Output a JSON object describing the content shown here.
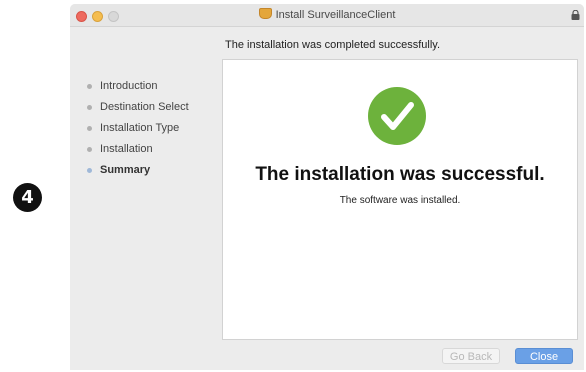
{
  "step_badge": "4",
  "window": {
    "title": "Install SurveillanceClient",
    "header": "The installation was completed successfully."
  },
  "sidebar": {
    "items": [
      {
        "label": "Introduction"
      },
      {
        "label": "Destination Select"
      },
      {
        "label": "Installation Type"
      },
      {
        "label": "Installation"
      },
      {
        "label": "Summary"
      }
    ],
    "active": "Summary"
  },
  "main": {
    "title": "The installation was successful.",
    "subtitle": "The software was installed."
  },
  "buttons": {
    "back": "Go Back",
    "close": "Close"
  },
  "icons": {
    "success": "checkmark-icon",
    "package": "package-icon",
    "lock": "lock-icon"
  },
  "colors": {
    "success_green": "#6db23c",
    "primary_button": "#6aa0e6",
    "close_light": "#ee6a5f",
    "minimize_light": "#f5bd4f"
  }
}
